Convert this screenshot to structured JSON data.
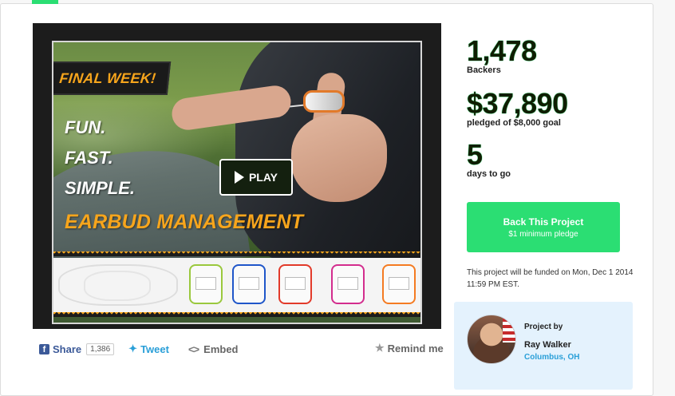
{
  "video": {
    "badge_text": "FINAL WEEK!",
    "slogan_lines": [
      "FUN.",
      "FAST.",
      "SIMPLE."
    ],
    "headline": "EARBUD MANAGEMENT",
    "play_label": "PLAY",
    "product_colors": [
      "#9ac83d",
      "#1f56c9",
      "#e23a2a",
      "#d32d8e",
      "#f47b22"
    ]
  },
  "share": {
    "facebook_label": "Share",
    "facebook_count": "1,386",
    "tweet_label": "Tweet",
    "embed_label": "Embed",
    "remind_label": "Remind me"
  },
  "stats": {
    "backers_number": "1,478",
    "backers_label": "Backers",
    "pledged_number": "$37,890",
    "pledged_label": "pledged of $8,000 goal",
    "days_number": "5",
    "days_label": "days to go"
  },
  "cta": {
    "label": "Back This Project",
    "sublabel": "$1 minimum pledge"
  },
  "funding_note": "This project will be funded on Mon, Dec 1 2014 11:59 PM EST.",
  "creator": {
    "heading": "Project by",
    "name": "Ray Walker",
    "location": "Columbus, OH"
  },
  "colors": {
    "accent_green": "#2bde73",
    "badge_orange": "#f7a51c",
    "facebook_blue": "#3b5998",
    "twitter_blue": "#2a9fd8"
  }
}
